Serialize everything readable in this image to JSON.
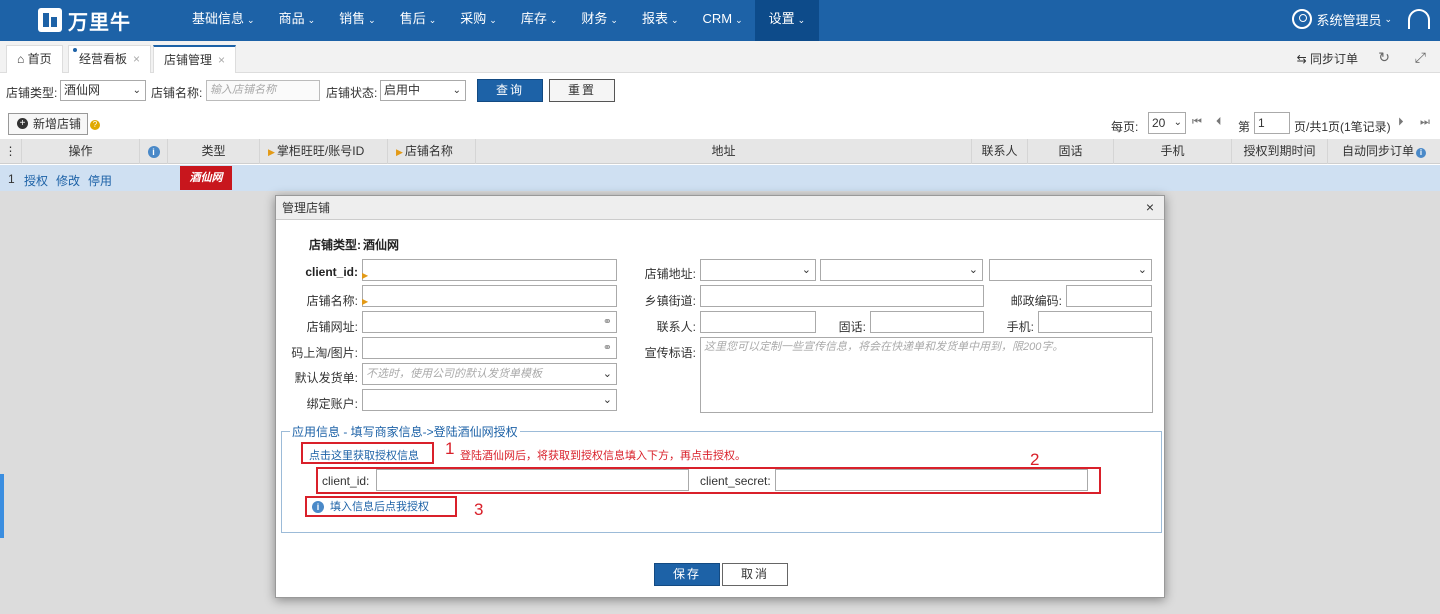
{
  "brand": {
    "name": "万里牛"
  },
  "nav": {
    "items": [
      "基础信息",
      "商品",
      "销售",
      "售后",
      "采购",
      "库存",
      "财务",
      "报表",
      "CRM",
      "设置"
    ],
    "active": "设置",
    "user": "系统管理员"
  },
  "tabs": [
    {
      "label": "首页"
    },
    {
      "label": "经营看板"
    },
    {
      "label": "店铺管理"
    }
  ],
  "tabbar": {
    "sync": "同步订单"
  },
  "filters": {
    "type_label": "店铺类型:",
    "type_value": "酒仙网",
    "name_label": "店铺名称:",
    "name_placeholder": "输入店铺名称",
    "status_label": "店铺状态:",
    "status_value": "启用中",
    "search": "查询",
    "reset": "重置"
  },
  "toolbar": {
    "add": "新增店铺"
  },
  "pager": {
    "per_page_label": "每页:",
    "per_page": "20",
    "page_prefix": "第",
    "page": "1",
    "page_suffix": "页/共1页(1笔记录)"
  },
  "grid": {
    "columns": [
      "操作",
      "类型",
      "掌柜旺旺/账号ID",
      "店铺名称",
      "地址",
      "联系人",
      "固话",
      "手机",
      "授权到期时间",
      "自动同步订单"
    ],
    "rows": [
      {
        "index": "1",
        "actions": [
          "授权",
          "修改",
          "停用"
        ],
        "type_logo": "酒仙网"
      }
    ]
  },
  "modal": {
    "title": "管理店铺",
    "shop_type_label": "店铺类型:",
    "shop_type_value": "酒仙网",
    "left_fields": {
      "client_id": "client_id:",
      "shop_name": "店铺名称:",
      "shop_url": "店铺网址:",
      "qr_image": "码上淘/图片:",
      "default_shipping": "默认发货单:",
      "default_shipping_placeholder": "不选时，使用公司的默认发货单模板",
      "bind_account": "绑定账户:"
    },
    "right_fields": {
      "address": "店铺地址:",
      "street": "乡镇街道:",
      "zip": "邮政编码:",
      "contact": "联系人:",
      "phone": "固话:",
      "mobile": "手机:",
      "slogan": "宣传标语:",
      "slogan_placeholder": "这里您可以定制一些宣传信息，将会在快递单和发货单中用到，限200字。"
    },
    "app_info": {
      "legend": "应用信息 - 填写商家信息->登陆酒仙网授权",
      "get_auth": "点击这里获取授权信息",
      "hint": "登陆酒仙网后，将获取到授权信息填入下方，再点击授权。",
      "client_id": "client_id:",
      "client_secret": "client_secret:",
      "authorize": "填入信息后点我授权",
      "steps": [
        "1",
        "2",
        "3"
      ]
    },
    "save": "保存",
    "cancel": "取消"
  }
}
